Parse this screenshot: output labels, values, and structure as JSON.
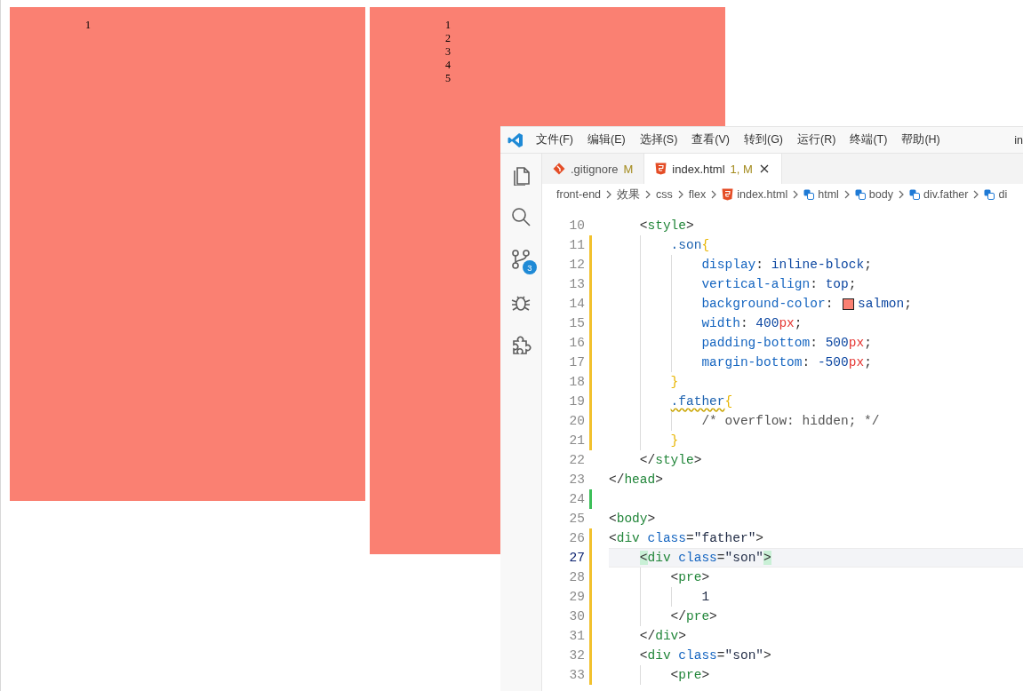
{
  "page": {
    "boxes": [
      {
        "lines": [
          "1"
        ]
      },
      {
        "lines": [
          "1",
          "2",
          "3",
          "4",
          "5"
        ]
      }
    ]
  },
  "editor_window": {
    "title": "in",
    "menu": [
      "文件(F)",
      "编辑(E)",
      "选择(S)",
      "查看(V)",
      "转到(G)",
      "运行(R)",
      "终端(T)",
      "帮助(H)"
    ],
    "activity_bar": [
      {
        "kind": "files"
      },
      {
        "kind": "search"
      },
      {
        "kind": "source-control",
        "badge": "3"
      },
      {
        "kind": "debug"
      },
      {
        "kind": "extensions"
      }
    ],
    "tabs": [
      {
        "kind": "git",
        "label": ".gitignore",
        "status": "M",
        "selected": false
      },
      {
        "kind": "html",
        "label": "index.html",
        "status": "1, M",
        "selected": true
      }
    ],
    "breadcrumb": [
      {
        "kind": "folder",
        "label": "front-end"
      },
      {
        "kind": "folder",
        "label": "效果"
      },
      {
        "kind": "folder",
        "label": "css"
      },
      {
        "kind": "folder",
        "label": "flex"
      },
      {
        "kind": "html",
        "label": "index.html"
      },
      {
        "kind": "element",
        "label": "html"
      },
      {
        "kind": "element",
        "label": "body"
      },
      {
        "kind": "element",
        "label": "div.father"
      },
      {
        "kind": "element",
        "label": "di"
      }
    ],
    "lines": [
      {
        "number": "10",
        "modified": false,
        "added": false,
        "current": false,
        "tokens": [
          {
            "kind": "punct",
            "text": "    <"
          },
          {
            "kind": "tag",
            "text": "style"
          },
          {
            "kind": "punct",
            "text": ">"
          }
        ]
      },
      {
        "number": "11",
        "modified": true,
        "added": false,
        "current": false,
        "tokens": [
          {
            "kind": "sel",
            "text": "        .son"
          },
          {
            "kind": "brace",
            "text": "{"
          }
        ]
      },
      {
        "number": "12",
        "modified": true,
        "added": false,
        "current": false,
        "tokens": [
          {
            "kind": "prop",
            "text": "            display"
          },
          {
            "kind": "punct",
            "text": ": "
          },
          {
            "kind": "val",
            "text": "inline-block"
          },
          {
            "kind": "punct",
            "text": ";"
          }
        ]
      },
      {
        "number": "13",
        "modified": true,
        "added": false,
        "current": false,
        "tokens": [
          {
            "kind": "prop",
            "text": "            vertical-align"
          },
          {
            "kind": "punct",
            "text": ": "
          },
          {
            "kind": "val",
            "text": "top"
          },
          {
            "kind": "punct",
            "text": ";"
          }
        ]
      },
      {
        "number": "14",
        "modified": true,
        "added": false,
        "current": false,
        "tokens": [
          {
            "kind": "prop",
            "text": "            background-color"
          },
          {
            "kind": "punct",
            "text": ": "
          },
          {
            "kind": "swatch",
            "color": "#fa8072"
          },
          {
            "kind": "val",
            "text": "salmon"
          },
          {
            "kind": "punct",
            "text": ";"
          }
        ]
      },
      {
        "number": "15",
        "modified": true,
        "added": false,
        "current": false,
        "tokens": [
          {
            "kind": "prop",
            "text": "            width"
          },
          {
            "kind": "punct",
            "text": ": "
          },
          {
            "kind": "val",
            "text": "400"
          },
          {
            "kind": "unit",
            "text": "px"
          },
          {
            "kind": "punct",
            "text": ";"
          }
        ]
      },
      {
        "number": "16",
        "modified": true,
        "added": false,
        "current": false,
        "tokens": [
          {
            "kind": "prop",
            "text": "            padding-bottom"
          },
          {
            "kind": "punct",
            "text": ": "
          },
          {
            "kind": "val",
            "text": "500"
          },
          {
            "kind": "unit",
            "text": "px"
          },
          {
            "kind": "punct",
            "text": ";"
          }
        ]
      },
      {
        "number": "17",
        "modified": true,
        "added": false,
        "current": false,
        "tokens": [
          {
            "kind": "prop",
            "text": "            margin-bottom"
          },
          {
            "kind": "punct",
            "text": ": "
          },
          {
            "kind": "val",
            "text": "-500"
          },
          {
            "kind": "unit",
            "text": "px"
          },
          {
            "kind": "punct",
            "text": ";"
          }
        ]
      },
      {
        "number": "18",
        "modified": true,
        "added": false,
        "current": false,
        "tokens": [
          {
            "kind": "brace",
            "text": "        }"
          }
        ]
      },
      {
        "number": "19",
        "modified": true,
        "added": false,
        "current": false,
        "tokens": [
          {
            "kind": "sel",
            "text": "        .father",
            "warning": true
          },
          {
            "kind": "brace",
            "text": "{"
          }
        ]
      },
      {
        "number": "20",
        "modified": true,
        "added": false,
        "current": false,
        "tokens": [
          {
            "kind": "comment",
            "text": "            /* overflow: hidden; */"
          }
        ]
      },
      {
        "number": "21",
        "modified": true,
        "added": false,
        "current": false,
        "tokens": [
          {
            "kind": "brace",
            "text": "        }"
          }
        ]
      },
      {
        "number": "22",
        "modified": false,
        "added": false,
        "current": false,
        "tokens": [
          {
            "kind": "punct",
            "text": "    </"
          },
          {
            "kind": "tag",
            "text": "style"
          },
          {
            "kind": "punct",
            "text": ">"
          }
        ]
      },
      {
        "number": "23",
        "modified": false,
        "added": false,
        "current": false,
        "tokens": [
          {
            "kind": "punct",
            "text": "</"
          },
          {
            "kind": "tag",
            "text": "head"
          },
          {
            "kind": "punct",
            "text": ">"
          }
        ]
      },
      {
        "number": "24",
        "modified": false,
        "added": true,
        "current": false
      },
      {
        "number": "25",
        "modified": false,
        "added": false,
        "current": false,
        "tokens": [
          {
            "kind": "punct",
            "text": "<"
          },
          {
            "kind": "tag",
            "text": "body"
          },
          {
            "kind": "punct",
            "text": ">"
          }
        ]
      },
      {
        "number": "26",
        "modified": true,
        "added": false,
        "current": false,
        "tokens": [
          {
            "kind": "punct",
            "text": "<"
          },
          {
            "kind": "tag",
            "text": "div"
          },
          {
            "kind": "attr",
            "text": " class"
          },
          {
            "kind": "punct",
            "text": "="
          },
          {
            "kind": "str",
            "text": "\"father\""
          },
          {
            "kind": "punct",
            "text": ">"
          }
        ]
      },
      {
        "number": "27",
        "modified": true,
        "added": false,
        "current": true,
        "tokens": [
          {
            "kind": "punct",
            "text": "    <",
            "matched": true
          },
          {
            "kind": "tag",
            "text": "div"
          },
          {
            "kind": "attr",
            "text": " class"
          },
          {
            "kind": "punct",
            "text": "="
          },
          {
            "kind": "str",
            "text": "\"son\""
          },
          {
            "kind": "punct",
            "text": ">",
            "matched": true
          }
        ]
      },
      {
        "number": "28",
        "modified": true,
        "added": false,
        "current": false,
        "tokens": [
          {
            "kind": "punct",
            "text": "        <"
          },
          {
            "kind": "tag",
            "text": "pre"
          },
          {
            "kind": "punct",
            "text": ">"
          }
        ]
      },
      {
        "number": "29",
        "modified": true,
        "added": false,
        "current": false,
        "tokens": [
          {
            "kind": "text",
            "text": "            1"
          }
        ]
      },
      {
        "number": "30",
        "modified": true,
        "added": false,
        "current": false,
        "tokens": [
          {
            "kind": "punct",
            "text": "        </"
          },
          {
            "kind": "tag",
            "text": "pre"
          },
          {
            "kind": "punct",
            "text": ">"
          }
        ]
      },
      {
        "number": "31",
        "modified": true,
        "added": false,
        "current": false,
        "tokens": [
          {
            "kind": "punct",
            "text": "    </"
          },
          {
            "kind": "tag",
            "text": "div"
          },
          {
            "kind": "punct",
            "text": ">"
          }
        ]
      },
      {
        "number": "32",
        "modified": true,
        "added": false,
        "current": false,
        "tokens": [
          {
            "kind": "punct",
            "text": "    <"
          },
          {
            "kind": "tag",
            "text": "div"
          },
          {
            "kind": "attr",
            "text": " class"
          },
          {
            "kind": "punct",
            "text": "="
          },
          {
            "kind": "str",
            "text": "\"son\""
          },
          {
            "kind": "punct",
            "text": ">"
          }
        ]
      },
      {
        "number": "33",
        "modified": true,
        "added": false,
        "current": false,
        "tokens": [
          {
            "kind": "punct",
            "text": "        <"
          },
          {
            "kind": "tag",
            "text": "pre"
          },
          {
            "kind": "punct",
            "text": ">"
          }
        ]
      }
    ]
  }
}
